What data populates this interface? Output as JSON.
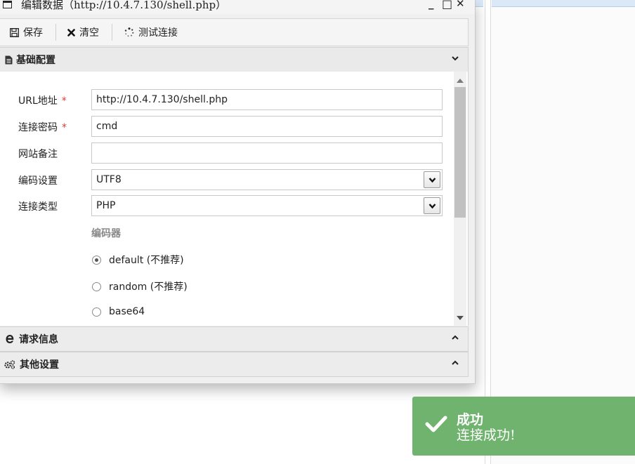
{
  "window": {
    "title": "编辑数据（http://10.4.7.130/shell.php）",
    "controls": {
      "minimize": "_",
      "maximize": "□",
      "close": "✕"
    }
  },
  "toolbar": {
    "save_label": "保存",
    "clear_label": "清空",
    "test_label": "测试连接"
  },
  "panels": {
    "basic": {
      "title": "基础配置",
      "icon": "document-icon"
    },
    "request": {
      "title": "请求信息",
      "icon": "ie-browser-icon"
    },
    "other": {
      "title": "其他设置",
      "icon": "gears-icon"
    }
  },
  "form": {
    "url": {
      "label": "URL地址",
      "required": "*",
      "value": "http://10.4.7.130/shell.php"
    },
    "password": {
      "label": "连接密码",
      "required": "*",
      "value": "cmd"
    },
    "note": {
      "label": "网站备注",
      "value": ""
    },
    "encoding": {
      "label": "编码设置",
      "value": "UTF8"
    },
    "type": {
      "label": "连接类型",
      "value": "PHP"
    },
    "encoder": {
      "heading": "编码器",
      "options": [
        {
          "label": "default (不推荐)",
          "selected": true
        },
        {
          "label": "random (不推荐)",
          "selected": false
        },
        {
          "label": "base64",
          "selected": false
        }
      ]
    }
  },
  "toast": {
    "title": "成功",
    "message": "连接成功!",
    "color": "#6fb36f"
  }
}
